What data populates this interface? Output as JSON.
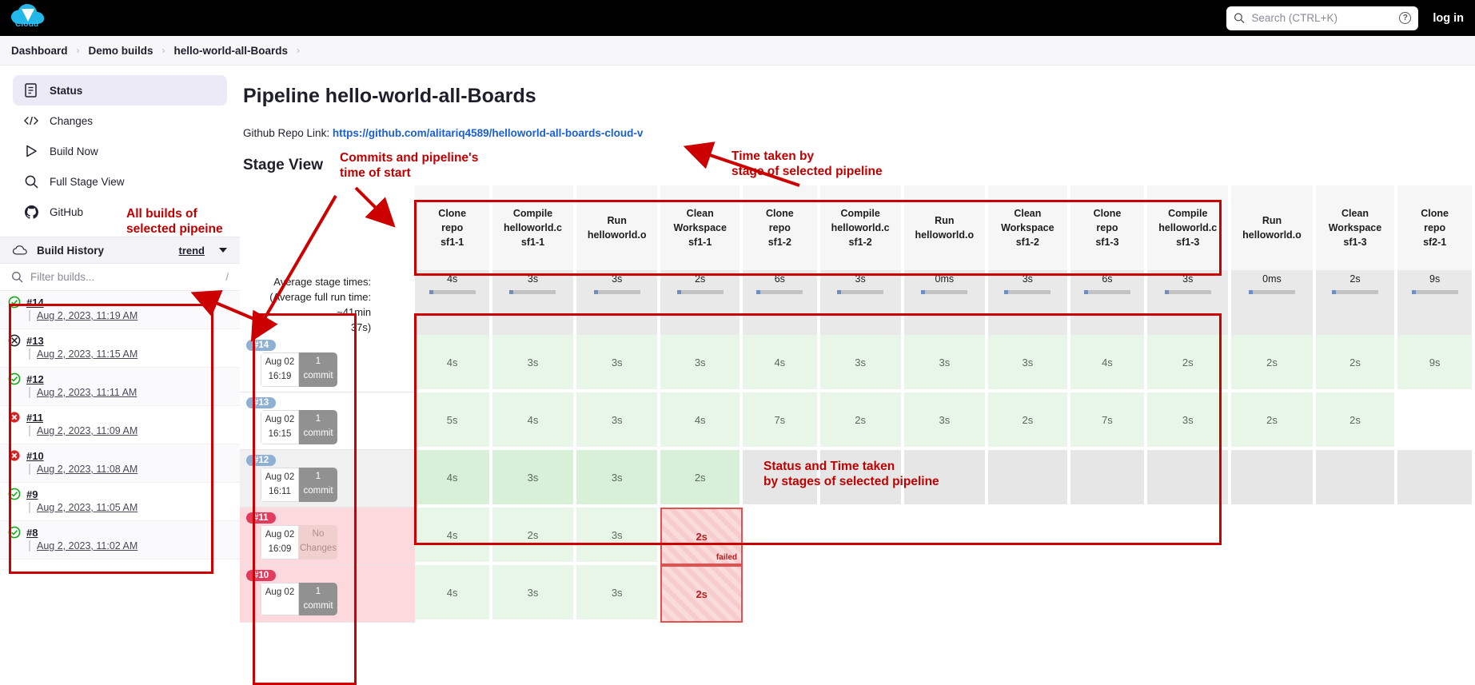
{
  "topbar": {
    "logo_text": "Cloud",
    "search_placeholder": "Search (CTRL+K)",
    "help_label": "?",
    "login_label": "log in"
  },
  "breadcrumb": {
    "items": [
      "Dashboard",
      "Demo builds",
      "hello-world-all-Boards"
    ],
    "separator": "›"
  },
  "sidebar": {
    "nav": [
      {
        "label": "Status",
        "icon": "document-icon",
        "active": true
      },
      {
        "label": "Changes",
        "icon": "code-icon",
        "active": false
      },
      {
        "label": "Build Now",
        "icon": "play-icon",
        "active": false
      },
      {
        "label": "Full Stage View",
        "icon": "search-icon",
        "active": false
      },
      {
        "label": "GitHub",
        "icon": "github-icon",
        "active": false
      }
    ],
    "build_history": {
      "title": "Build History",
      "trend_label": "trend",
      "filter_placeholder": "Filter builds...",
      "filter_shortcut": "/",
      "builds": [
        {
          "number": "#14",
          "date": "Aug 2, 2023, 11:19 AM",
          "status": "success"
        },
        {
          "number": "#13",
          "date": "Aug 2, 2023, 11:15 AM",
          "status": "aborted"
        },
        {
          "number": "#12",
          "date": "Aug 2, 2023, 11:11 AM",
          "status": "success"
        },
        {
          "number": "#11",
          "date": "Aug 2, 2023, 11:09 AM",
          "status": "failed"
        },
        {
          "number": "#10",
          "date": "Aug 2, 2023, 11:08 AM",
          "status": "failed"
        },
        {
          "number": "#9",
          "date": "Aug 2, 2023, 11:05 AM",
          "status": "success"
        },
        {
          "number": "#8",
          "date": "Aug 2, 2023, 11:02 AM",
          "status": "success"
        }
      ]
    }
  },
  "main": {
    "page_title": "Pipeline hello-world-all-Boards",
    "repo_label": "Github Repo Link:",
    "repo_url": "https://github.com/alitariq4589/helloworld-all-boards-cloud-v",
    "stage_view_title": "Stage View",
    "average_label_line1": "Average stage times:",
    "average_label_line2": "(Average full run time: ~41min",
    "average_label_line3": "37s)"
  },
  "stage_table": {
    "columns": [
      {
        "name": "Clone repo sf1-1",
        "lines": [
          "Clone",
          "repo",
          "sf1-1"
        ],
        "avg": "4s"
      },
      {
        "name": "Compile helloworld.c sf1-1",
        "lines": [
          "Compile",
          "helloworld.c",
          "sf1-1"
        ],
        "avg": "3s"
      },
      {
        "name": "Run helloworld.o",
        "lines": [
          "Run",
          "helloworld.o"
        ],
        "avg": "3s"
      },
      {
        "name": "Clean Workspace sf1-1",
        "lines": [
          "Clean",
          "Workspace",
          "sf1-1"
        ],
        "avg": "2s"
      },
      {
        "name": "Clone repo sf1-2",
        "lines": [
          "Clone",
          "repo",
          "sf1-2"
        ],
        "avg": "6s"
      },
      {
        "name": "Compile helloworld.c sf1-2",
        "lines": [
          "Compile",
          "helloworld.c",
          "sf1-2"
        ],
        "avg": "3s"
      },
      {
        "name": "Run helloworld.o",
        "lines": [
          "Run",
          "helloworld.o"
        ],
        "avg": "0ms"
      },
      {
        "name": "Clean Workspace sf1-2",
        "lines": [
          "Clean",
          "Workspace",
          "sf1-2"
        ],
        "avg": "3s"
      },
      {
        "name": "Clone repo sf1-3",
        "lines": [
          "Clone",
          "repo",
          "sf1-3"
        ],
        "avg": "6s"
      },
      {
        "name": "Compile helloworld.c sf1-3",
        "lines": [
          "Compile",
          "helloworld.c",
          "sf1-3"
        ],
        "avg": "3s"
      },
      {
        "name": "Run helloworld.o",
        "lines": [
          "Run",
          "helloworld.o"
        ],
        "avg": "0ms"
      },
      {
        "name": "Clean Workspace sf1-3",
        "lines": [
          "Clean",
          "Workspace",
          "sf1-3"
        ],
        "avg": "2s"
      },
      {
        "name": "Clone repo sf2-1",
        "lines": [
          "Clone",
          "repo",
          "sf2-1"
        ],
        "avg": "9s"
      }
    ],
    "rows": [
      {
        "build": "#14",
        "date": "Aug 02",
        "time": "16:19",
        "commit_count": "1",
        "commit_label": "commit",
        "commit_state": "normal",
        "row_state": "normal",
        "cells": [
          {
            "value": "4s",
            "state": "ok"
          },
          {
            "value": "3s",
            "state": "ok"
          },
          {
            "value": "3s",
            "state": "ok"
          },
          {
            "value": "3s",
            "state": "ok"
          },
          {
            "value": "4s",
            "state": "ok"
          },
          {
            "value": "3s",
            "state": "ok"
          },
          {
            "value": "3s",
            "state": "ok"
          },
          {
            "value": "3s",
            "state": "ok"
          },
          {
            "value": "4s",
            "state": "ok"
          },
          {
            "value": "2s",
            "state": "ok"
          },
          {
            "value": "2s",
            "state": "ok"
          },
          {
            "value": "2s",
            "state": "ok"
          },
          {
            "value": "9s",
            "state": "ok"
          }
        ]
      },
      {
        "build": "#13",
        "date": "Aug 02",
        "time": "16:15",
        "commit_count": "1",
        "commit_label": "commit",
        "commit_state": "normal",
        "row_state": "normal",
        "cells": [
          {
            "value": "5s",
            "state": "ok"
          },
          {
            "value": "4s",
            "state": "ok"
          },
          {
            "value": "3s",
            "state": "ok"
          },
          {
            "value": "4s",
            "state": "ok"
          },
          {
            "value": "7s",
            "state": "ok"
          },
          {
            "value": "2s",
            "state": "ok"
          },
          {
            "value": "3s",
            "state": "ok"
          },
          {
            "value": "2s",
            "state": "ok"
          },
          {
            "value": "7s",
            "state": "ok"
          },
          {
            "value": "3s",
            "state": "ok"
          },
          {
            "value": "2s",
            "state": "ok"
          },
          {
            "value": "2s",
            "state": "ok"
          },
          {
            "value": "",
            "state": "none"
          }
        ]
      },
      {
        "build": "#12",
        "date": "Aug 02",
        "time": "16:11",
        "commit_count": "1",
        "commit_label": "commit",
        "commit_state": "normal",
        "row_state": "alt",
        "cells": [
          {
            "value": "4s",
            "state": "ok2"
          },
          {
            "value": "3s",
            "state": "ok2"
          },
          {
            "value": "3s",
            "state": "ok2"
          },
          {
            "value": "2s",
            "state": "ok2"
          },
          {
            "value": "",
            "state": "skip"
          },
          {
            "value": "",
            "state": "skip"
          },
          {
            "value": "",
            "state": "skip"
          },
          {
            "value": "",
            "state": "skip"
          },
          {
            "value": "",
            "state": "skip"
          },
          {
            "value": "",
            "state": "skip"
          },
          {
            "value": "",
            "state": "skip"
          },
          {
            "value": "",
            "state": "skip"
          },
          {
            "value": "",
            "state": "skip"
          }
        ]
      },
      {
        "build": "#11",
        "date": "Aug 02",
        "time": "16:09",
        "commit_count": "No",
        "commit_label": "Changes",
        "commit_state": "nochange",
        "row_state": "fail",
        "cells": [
          {
            "value": "4s",
            "state": "ok"
          },
          {
            "value": "2s",
            "state": "ok"
          },
          {
            "value": "3s",
            "state": "ok"
          },
          {
            "value": "2s",
            "state": "fail",
            "tag": "failed"
          },
          {
            "value": "",
            "state": "none"
          },
          {
            "value": "",
            "state": "none"
          },
          {
            "value": "",
            "state": "none"
          },
          {
            "value": "",
            "state": "none"
          },
          {
            "value": "",
            "state": "none"
          },
          {
            "value": "",
            "state": "none"
          },
          {
            "value": "",
            "state": "none"
          },
          {
            "value": "",
            "state": "none"
          },
          {
            "value": "",
            "state": "none"
          }
        ]
      },
      {
        "build": "#10",
        "date": "Aug 02",
        "time": "",
        "commit_count": "1",
        "commit_label": "commit",
        "commit_state": "normal",
        "row_state": "fail",
        "cells": [
          {
            "value": "4s",
            "state": "ok"
          },
          {
            "value": "3s",
            "state": "ok"
          },
          {
            "value": "3s",
            "state": "ok"
          },
          {
            "value": "2s",
            "state": "failtext"
          },
          {
            "value": "",
            "state": "none"
          },
          {
            "value": "",
            "state": "none"
          },
          {
            "value": "",
            "state": "none"
          },
          {
            "value": "",
            "state": "none"
          },
          {
            "value": "",
            "state": "none"
          },
          {
            "value": "",
            "state": "none"
          },
          {
            "value": "",
            "state": "none"
          },
          {
            "value": "",
            "state": "none"
          },
          {
            "value": "",
            "state": "none"
          }
        ]
      }
    ]
  },
  "annotations": [
    {
      "id": "all-builds",
      "text": "All builds of\nselected pipeine"
    },
    {
      "id": "commits",
      "text": "Commits and pipeline's\ntime of start"
    },
    {
      "id": "time-taken",
      "text": "Time taken by\nstage of selected pipeline"
    },
    {
      "id": "status-time",
      "text": "Status and Time taken\nby stages of selected pipeline"
    }
  ],
  "colors": {
    "annotation": "#c00000",
    "link": "#1a5fd6",
    "success": "#18a718",
    "failure": "#d62424",
    "aborted": "#1f1f2c",
    "accent": "#3bb8e8"
  }
}
